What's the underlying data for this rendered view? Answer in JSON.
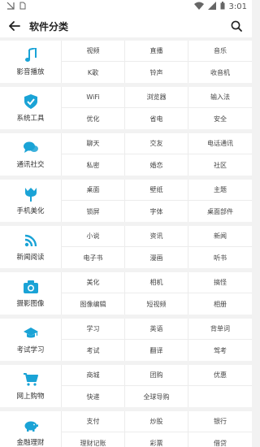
{
  "status_bar": {
    "time": "3:01"
  },
  "header": {
    "title": "软件分类"
  },
  "theme": {
    "accent": "#1aa3d6"
  },
  "categories": [
    {
      "label": "影音播放",
      "icon": "music-note-icon",
      "items": [
        "视频",
        "直播",
        "音乐",
        "K歌",
        "铃声",
        "收音机"
      ]
    },
    {
      "label": "系统工具",
      "icon": "shield-check-icon",
      "items": [
        "WiFi",
        "浏览器",
        "输入法",
        "优化",
        "省电",
        "安全"
      ]
    },
    {
      "label": "通讯社交",
      "icon": "chat-bubbles-icon",
      "items": [
        "聊天",
        "交友",
        "电话通讯",
        "私密",
        "婚恋",
        "社区"
      ]
    },
    {
      "label": "手机美化",
      "icon": "tulip-icon",
      "items": [
        "桌面",
        "壁纸",
        "主题",
        "锁屏",
        "字体",
        "桌面部件"
      ]
    },
    {
      "label": "新闻阅读",
      "icon": "rss-icon",
      "items": [
        "小说",
        "资讯",
        "新闻",
        "电子书",
        "漫画",
        "听书"
      ]
    },
    {
      "label": "摄影图像",
      "icon": "camera-icon",
      "items": [
        "美化",
        "相机",
        "搞怪",
        "图像编辑",
        "短视频",
        "相册"
      ]
    },
    {
      "label": "考试学习",
      "icon": "graduation-cap-icon",
      "items": [
        "学习",
        "英语",
        "背单词",
        "考试",
        "翻译",
        "驾考"
      ]
    },
    {
      "label": "网上购物",
      "icon": "shopping-cart-icon",
      "items": [
        "商城",
        "团购",
        "优惠",
        "快递",
        "全球导购",
        ""
      ]
    },
    {
      "label": "金融理财",
      "icon": "piggy-bank-icon",
      "items": [
        "支付",
        "炒股",
        "银行",
        "理财记账",
        "彩票",
        "借贷"
      ]
    }
  ]
}
